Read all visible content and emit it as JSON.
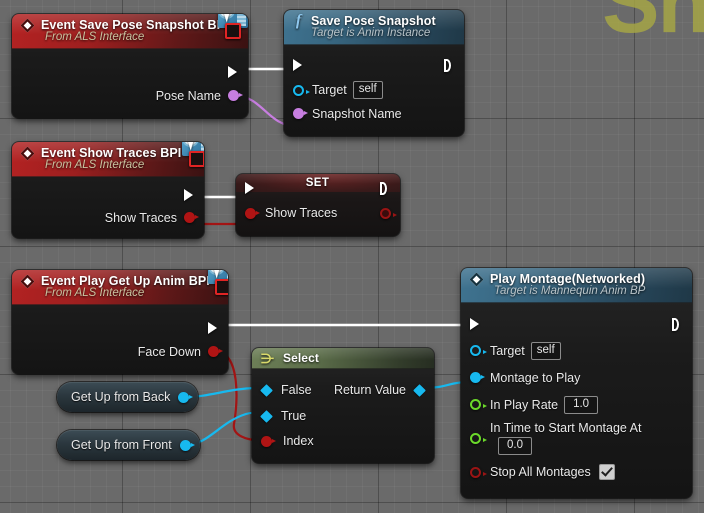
{
  "canvas": {
    "background_color": "#6a6a6a",
    "grid_color": "#5e5e5e",
    "watermark_text": "Sh"
  },
  "nodes": [
    {
      "id": "event-save-pose-snapshot",
      "kind": "event",
      "title": "Event Save Pose Snapshot BPI",
      "subtitle": "From ALS Interface",
      "badge": "blueprint-interface-badge",
      "outputs": [
        {
          "label": "",
          "type": "exec"
        },
        {
          "label": "Pose Name",
          "type": "name"
        }
      ]
    },
    {
      "id": "save-pose-snapshot",
      "kind": "function",
      "title": "Save Pose Snapshot",
      "subtitle": "Target is Anim Instance",
      "inputs": [
        {
          "label": "",
          "type": "exec"
        },
        {
          "label": "Target",
          "type": "object",
          "value": "self"
        },
        {
          "label": "Snapshot Name",
          "type": "name"
        }
      ],
      "outputs": [
        {
          "label": "",
          "type": "exec"
        }
      ]
    },
    {
      "id": "event-show-traces",
      "kind": "event",
      "title": "Event Show Traces BPI",
      "subtitle": "From ALS Interface",
      "badge": "blueprint-interface-badge",
      "outputs": [
        {
          "label": "",
          "type": "exec"
        },
        {
          "label": "Show Traces",
          "type": "bool"
        }
      ]
    },
    {
      "id": "set-show-traces",
      "kind": "set",
      "title": "SET",
      "inputs": [
        {
          "label": "",
          "type": "exec"
        },
        {
          "label": "Show Traces",
          "type": "bool"
        }
      ],
      "outputs": [
        {
          "label": "",
          "type": "exec"
        },
        {
          "label": "",
          "type": "bool"
        }
      ]
    },
    {
      "id": "event-play-get-up-anim",
      "kind": "event",
      "title": "Event Play Get Up Anim BPI",
      "subtitle": "From ALS Interface",
      "badge": "blueprint-interface-badge",
      "outputs": [
        {
          "label": "",
          "type": "exec"
        },
        {
          "label": "Face Down",
          "type": "bool"
        }
      ]
    },
    {
      "id": "getter-get-up-from-back",
      "kind": "getter",
      "title": "Get Up from Back",
      "output_type": "object"
    },
    {
      "id": "getter-get-up-from-front",
      "kind": "getter",
      "title": "Get Up from Front",
      "output_type": "object"
    },
    {
      "id": "select-node",
      "kind": "pure",
      "title": "Select",
      "inputs": [
        {
          "label": "False",
          "type": "wildcard"
        },
        {
          "label": "True",
          "type": "wildcard"
        },
        {
          "label": "Index",
          "type": "bool"
        }
      ],
      "outputs": [
        {
          "label": "Return Value",
          "type": "wildcard"
        }
      ]
    },
    {
      "id": "play-montage-networked",
      "kind": "event",
      "title": "Play Montage(Networked)",
      "subtitle": "Target is Mannequin Anim BP",
      "inputs": [
        {
          "label": "",
          "type": "exec"
        },
        {
          "label": "Target",
          "type": "object",
          "value": "self"
        },
        {
          "label": "Montage to Play",
          "type": "object"
        },
        {
          "label": "In Play Rate",
          "type": "float",
          "value": "1.0"
        },
        {
          "label": "In Time to Start Montage At",
          "type": "float",
          "value": "0.0"
        },
        {
          "label": "Stop All Montages",
          "type": "bool",
          "value": "checked"
        }
      ],
      "outputs": [
        {
          "label": "",
          "type": "exec"
        }
      ]
    }
  ],
  "labels": {
    "event_save_pose_title": "Event Save Pose Snapshot BPI",
    "event_save_pose_sub": "From ALS Interface",
    "pose_name": "Pose Name",
    "save_pose_title": "Save Pose Snapshot",
    "save_pose_sub": "Target is Anim Instance",
    "target": "Target",
    "self_value": "self",
    "snapshot_name": "Snapshot Name",
    "event_show_traces_title": "Event Show Traces BPI",
    "event_show_traces_sub": "From ALS Interface",
    "show_traces": "Show Traces",
    "set_title": "SET",
    "set_show_traces": "Show Traces",
    "event_get_up_title": "Event Play Get Up Anim BPI",
    "event_get_up_sub": "From ALS Interface",
    "face_down": "Face Down",
    "get_up_back": "Get Up from Back",
    "get_up_front": "Get Up from Front",
    "select_title": "Select",
    "select_false": "False",
    "select_true": "True",
    "select_index": "Index",
    "select_return": "Return Value",
    "montage_title": "Play Montage(Networked)",
    "montage_sub": "Target is Mannequin Anim BP",
    "montage_target": "Target",
    "montage_self": "self",
    "montage_to_play": "Montage to Play",
    "in_play_rate": "In Play Rate",
    "in_play_rate_value": "1.0",
    "in_time_to_start": "In Time to Start Montage At",
    "in_time_value": "0.0",
    "stop_all_montages": "Stop All Montages"
  },
  "colors": {
    "exec_wire": "#ffffff",
    "name_wire": "#c77ee0",
    "bool_wire": "#a31414",
    "object_wire": "#17b9ef",
    "event_header": "#9d1f1f",
    "function_header": "#37657f",
    "pure_header": "#5c6e4a"
  }
}
